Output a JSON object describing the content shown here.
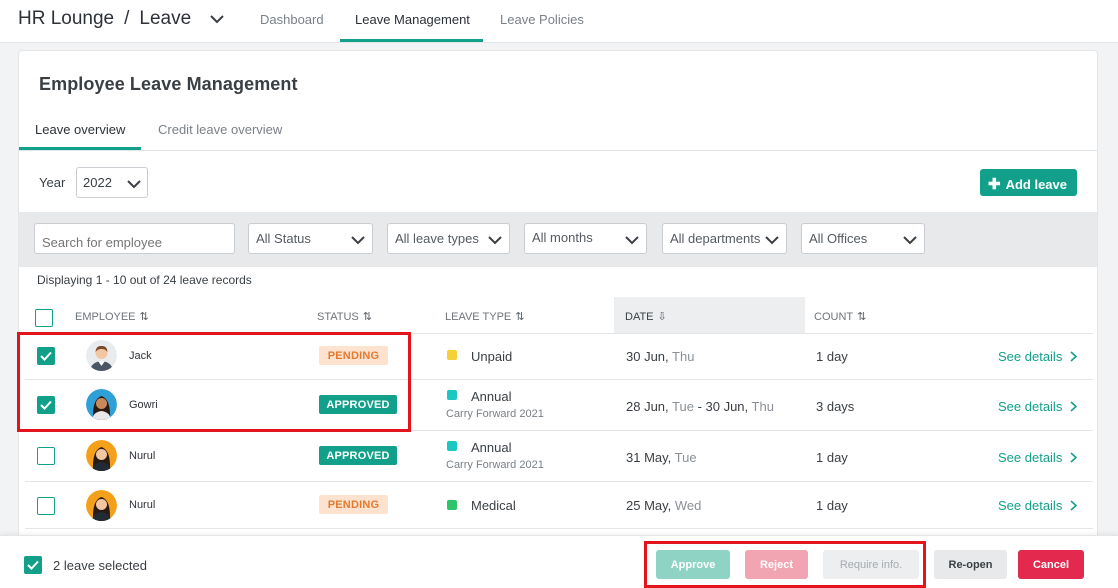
{
  "header": {
    "app_name": "HR Lounge",
    "separator": "/",
    "module": "Leave",
    "tabs": [
      "Dashboard",
      "Leave Management",
      "Leave Policies"
    ],
    "active_tab": "Leave Management"
  },
  "page": {
    "title": "Employee Leave Management",
    "subtabs": [
      "Leave overview",
      "Credit leave overview"
    ],
    "active_subtab": "Leave overview",
    "year_label": "Year",
    "year_value": "2022",
    "add_leave_label": "Add leave"
  },
  "filters": {
    "search_placeholder": "Search for employee",
    "status": "All Status",
    "leave_types": "All leave types",
    "months": "All months",
    "departments": "All departments",
    "offices": "All Offices"
  },
  "display_count": "Displaying 1 - 10 out of 24 leave records",
  "table": {
    "headers": {
      "employee": "EMPLOYEE",
      "status": "STATUS",
      "leave_type": "LEAVE TYPE",
      "date": "DATE",
      "count": "COUNT"
    },
    "rows": [
      {
        "name": "Jack",
        "status": "PENDING",
        "leave_type": "Unpaid",
        "leave_sub": "",
        "date_main": "30 Jun,",
        "date_day": " Thu",
        "date_mid": "",
        "date_day2": "",
        "count": "1 day",
        "action": "See details",
        "checked": true,
        "type_color": "#f7d038"
      },
      {
        "name": "Gowri",
        "status": "APPROVED",
        "leave_type": "Annual",
        "leave_sub": "Carry Forward 2021",
        "date_main": "28 Jun,",
        "date_day": " Tue",
        "date_mid": " - 30 Jun,",
        "date_day2": " Thu",
        "count": "3 days",
        "action": "See details",
        "checked": true,
        "type_color": "#1cc7c1"
      },
      {
        "name": "Nurul",
        "status": "APPROVED",
        "leave_type": "Annual",
        "leave_sub": "Carry Forward 2021",
        "date_main": "31 May,",
        "date_day": " Tue",
        "date_mid": "",
        "date_day2": "",
        "count": "1 day",
        "action": "See details",
        "checked": false,
        "type_color": "#1cc7c1"
      },
      {
        "name": "Nurul",
        "status": "PENDING",
        "leave_type": "Medical",
        "leave_sub": "",
        "date_main": "25 May,",
        "date_day": " Wed",
        "date_mid": "",
        "date_day2": "",
        "count": "1 day",
        "action": "See details",
        "checked": false,
        "type_color": "#2ec46a"
      }
    ]
  },
  "bottom_bar": {
    "selected_text": "2 leave selected",
    "approve": "Approve",
    "reject": "Reject",
    "require_info": "Require info.",
    "reopen": "Re-open",
    "cancel": "Cancel"
  },
  "colors": {
    "accent": "#12a08a",
    "pending_bg": "#fde3cf",
    "pending_text": "#e47a2e",
    "cancel": "#e3294d",
    "highlight": "#e3141b"
  }
}
